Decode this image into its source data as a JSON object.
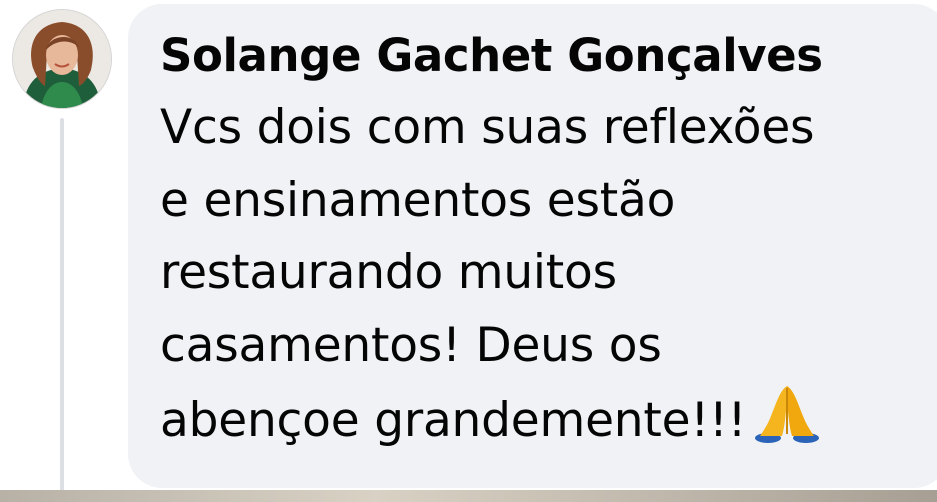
{
  "comment": {
    "author": "Solange Gachet Gonçalves",
    "lines": [
      "Vcs dois com suas reflexões",
      "e ensinamentos estão",
      "restaurando muitos",
      "casamentos! Deus os",
      "abençoe grandemente!!!"
    ],
    "emoji": "folded-hands-icon"
  },
  "colors": {
    "bubble_background": "#f0f2f5",
    "text": "#050505",
    "thread_line": "#dcdfe3"
  }
}
